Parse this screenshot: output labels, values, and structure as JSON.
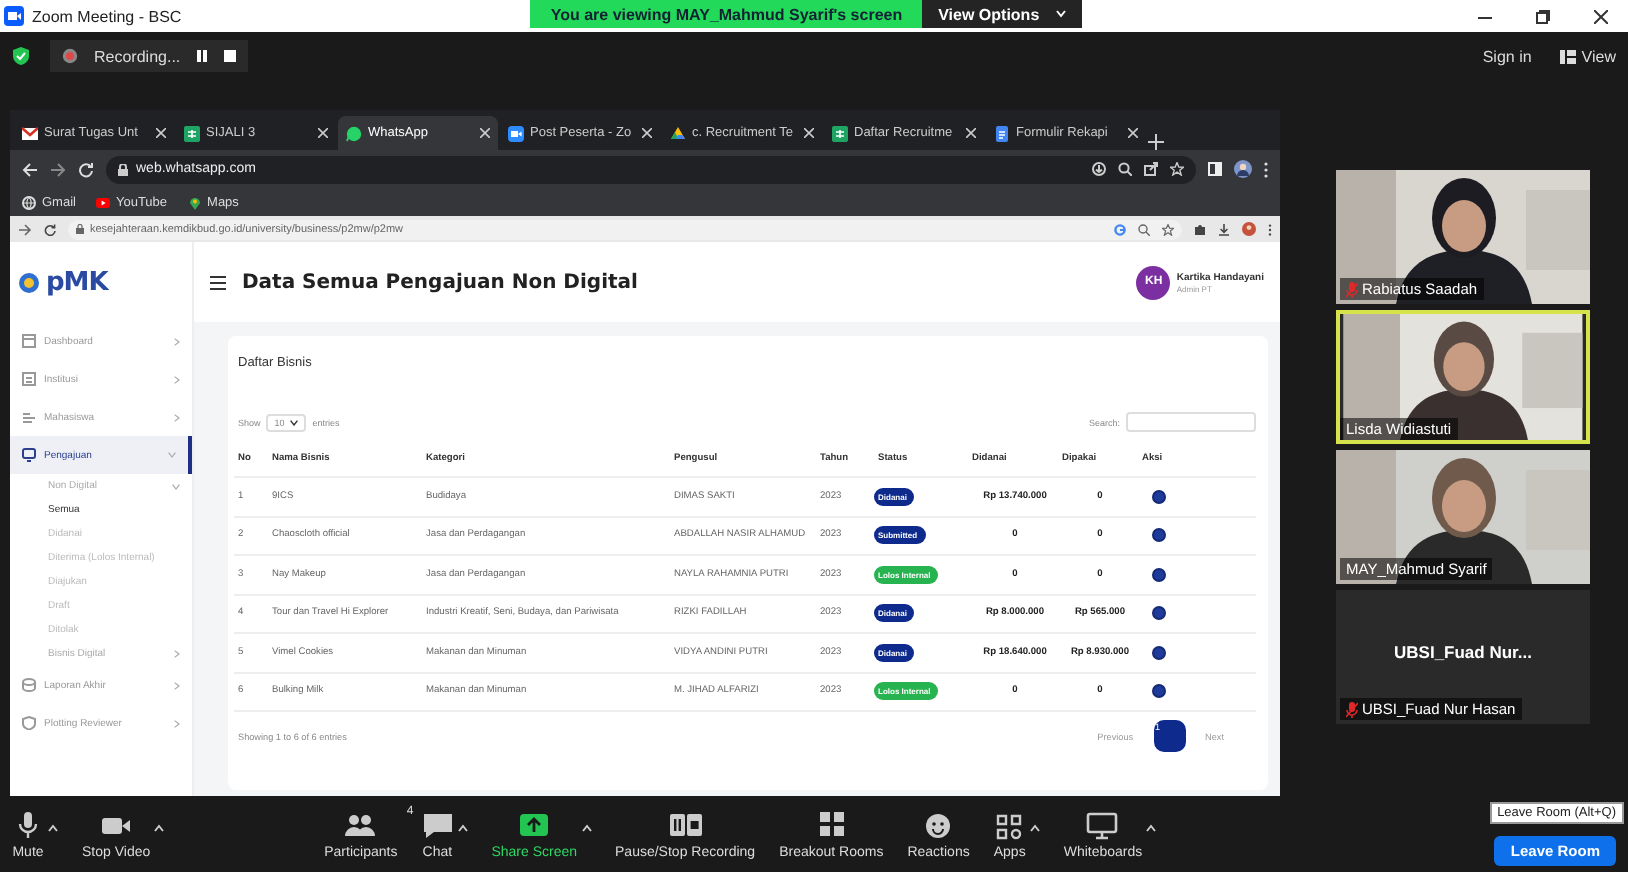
{
  "window": {
    "title": "Zoom Meeting - BSC"
  },
  "share_banner": {
    "text": "You are viewing MAY_Mahmud Syarif's screen",
    "button": "View Options"
  },
  "recording": {
    "label": "Recording..."
  },
  "top_right": {
    "sign_in": "Sign in",
    "view": "View"
  },
  "browser": {
    "tabs": [
      {
        "label": "Surat Tugas Unt",
        "kind": "mail",
        "selected": false
      },
      {
        "label": "SIJALI 3",
        "kind": "sheet",
        "selected": false
      },
      {
        "label": "WhatsApp",
        "kind": "chat",
        "selected": true
      },
      {
        "label": "Post Peserta - Zo",
        "kind": "video",
        "selected": false
      },
      {
        "label": "c. Recruitment Te",
        "kind": "drive",
        "selected": false
      },
      {
        "label": "Daftar Recruitme",
        "kind": "sheet",
        "selected": false
      },
      {
        "label": "Formulir Rekapi",
        "kind": "doc",
        "selected": false
      }
    ],
    "address": "web.whatsapp.com",
    "bookmarks": [
      {
        "label": "Gmail",
        "kind": "globe"
      },
      {
        "label": "YouTube",
        "kind": "play"
      },
      {
        "label": "Maps",
        "kind": "pin"
      }
    ],
    "inner_address": "kesejahteraan.kemdikbud.go.id/university/business/p2mw/p2mw"
  },
  "page": {
    "logo": "pMK",
    "title": "Data Semua Pengajuan Non Digital",
    "user": {
      "initials": "KH",
      "name": "Kartika Handayani",
      "role": "Admin PT"
    },
    "sidebar": {
      "items": [
        {
          "label": "Dashboard",
          "selected": false,
          "expanded": false
        },
        {
          "label": "Institusi",
          "selected": false,
          "expanded": false
        },
        {
          "label": "Mahasiswa",
          "selected": false,
          "expanded": false
        },
        {
          "label": "Pengajuan",
          "selected": true,
          "expanded": true,
          "children": [
            {
              "label": "Non Digital",
              "selected": false,
              "expanded": true,
              "children": [
                {
                  "label": "Semua",
                  "selected": true
                },
                {
                  "label": "Didanai",
                  "selected": false
                },
                {
                  "label": "Diterima (Lolos Internal)",
                  "selected": false
                },
                {
                  "label": "Diajukan",
                  "selected": false
                },
                {
                  "label": "Draft",
                  "selected": false
                },
                {
                  "label": "Ditolak",
                  "selected": false
                }
              ]
            },
            {
              "label": "Bisnis Digital",
              "selected": false,
              "expanded": false
            }
          ]
        },
        {
          "label": "Laporan Akhir",
          "selected": false,
          "expanded": false
        },
        {
          "label": "Plotting Reviewer",
          "selected": false,
          "expanded": false
        }
      ]
    },
    "card": {
      "title": "Daftar Bisnis",
      "show": "Show",
      "page_size": "10",
      "entries": "entries",
      "search_label": "Search:",
      "table": {
        "columns": [
          "No",
          "Nama Bisnis",
          "Kategori",
          "Pengusul",
          "Tahun",
          "Status",
          "Didanai",
          "Dipakai",
          "Aksi"
        ],
        "rows": [
          {
            "no": "1",
            "name": "9ICS",
            "category": "Budidaya",
            "proposer": "DIMAS SAKTI",
            "year": "2023",
            "status": {
              "label": "Didanai",
              "kind": "funded"
            },
            "funded": "Rp 13.740.000",
            "used": "0"
          },
          {
            "no": "2",
            "name": "Chaoscloth official",
            "category": "Jasa dan Perdagangan",
            "proposer": "ABDALLAH NASIR ALHAMUD",
            "year": "2023",
            "status": {
              "label": "Submitted",
              "kind": "submitted"
            },
            "funded": "0",
            "used": "0"
          },
          {
            "no": "3",
            "name": "Nay Makeup",
            "category": "Jasa dan Perdagangan",
            "proposer": "NAYLA RAHAMNIA PUTRI",
            "year": "2023",
            "status": {
              "label": "Lolos Internal",
              "kind": "passed"
            },
            "funded": "0",
            "used": "0"
          },
          {
            "no": "4",
            "name": "Tour dan Travel Hi Explorer",
            "category": "Industri Kreatif, Seni, Budaya, dan Pariwisata",
            "proposer": "RIZKI FADILLAH",
            "year": "2023",
            "status": {
              "label": "Didanai",
              "kind": "funded"
            },
            "funded": "Rp 8.000.000",
            "used": "Rp 565.000"
          },
          {
            "no": "5",
            "name": "Vimel Cookies",
            "category": "Makanan dan Minuman",
            "proposer": "VIDYA ANDINI PUTRI",
            "year": "2023",
            "status": {
              "label": "Didanai",
              "kind": "funded"
            },
            "funded": "Rp 18.640.000",
            "used": "Rp 8.930.000"
          },
          {
            "no": "6",
            "name": "Bulking Milk",
            "category": "Makanan dan Minuman",
            "proposer": "M. JIHAD ALFARIZI",
            "year": "2023",
            "status": {
              "label": "Lolos Internal",
              "kind": "passed"
            },
            "funded": "0",
            "used": "0"
          }
        ]
      },
      "footer": "Showing 1 to 6 of 6 entries",
      "pagination": [
        {
          "label": "Previous",
          "kind": "text",
          "selected": false
        },
        {
          "label": "1",
          "kind": "page",
          "selected": true
        },
        {
          "label": "Next",
          "kind": "text",
          "selected": false
        }
      ]
    }
  },
  "participants": [
    {
      "name": "Rabiatus Saadah",
      "kind": "video",
      "muted": true,
      "speaking": false
    },
    {
      "name": "Lisda Widiastuti",
      "kind": "video",
      "muted": false,
      "speaking": true
    },
    {
      "name": "MAY_Mahmud Syarif",
      "kind": "video",
      "muted": false,
      "speaking": false
    },
    {
      "name": "UBSI_Fuad Nur Hasan",
      "display": "UBSI_Fuad  Nur...",
      "kind": "name",
      "muted": true,
      "speaking": false
    }
  ],
  "toolbar": {
    "items": [
      {
        "label": "Mute",
        "kind": "mic",
        "caret": true
      },
      {
        "label": "Stop Video",
        "kind": "camera",
        "caret": true
      },
      {
        "label": "Participants",
        "kind": "people",
        "count": "4",
        "caret": false
      },
      {
        "label": "Chat",
        "kind": "chat",
        "caret": true
      },
      {
        "label": "Share Screen",
        "kind": "share",
        "caret": true
      },
      {
        "label": "Pause/Stop Recording",
        "kind": "record",
        "caret": false
      },
      {
        "label": "Breakout Rooms",
        "kind": "rooms",
        "caret": false
      },
      {
        "label": "Reactions",
        "kind": "react",
        "caret": false
      },
      {
        "label": "Apps",
        "kind": "apps",
        "caret": true
      },
      {
        "label": "Whiteboards",
        "kind": "board",
        "caret": true
      }
    ],
    "leave": "Leave Room",
    "tooltip": "Leave Room (Alt+Q)"
  }
}
